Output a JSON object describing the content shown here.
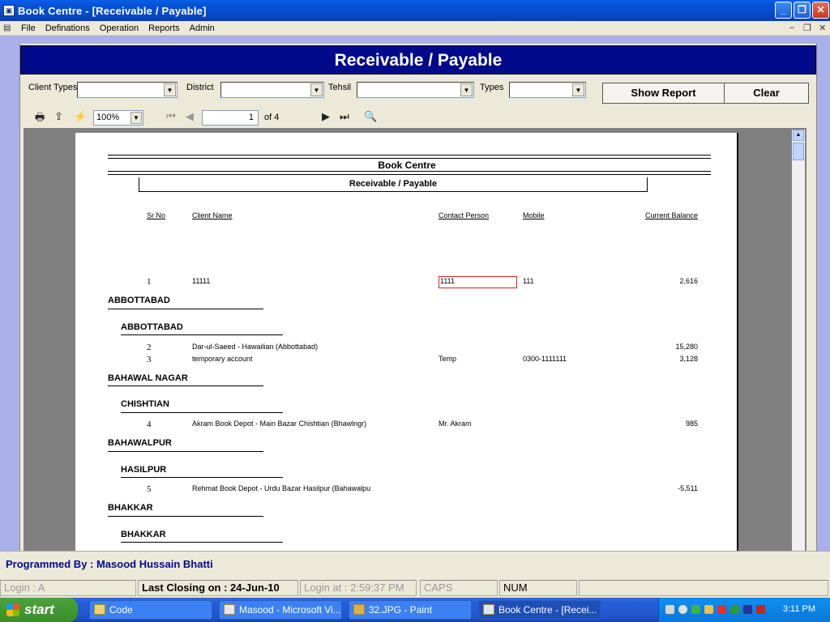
{
  "window": {
    "title": "Book Centre  - [Receivable / Payable]"
  },
  "menu": {
    "items": [
      "File",
      "Definations",
      "Operation",
      "Reports",
      "Admin"
    ]
  },
  "header": {
    "title": "Receivable / Payable"
  },
  "filters": {
    "client_types_label": "Client Types",
    "district_label": "District",
    "tehsil_label": "Tehsil",
    "types_label": "Types",
    "client_types_value": "",
    "district_value": "",
    "tehsil_value": "",
    "types_value": "",
    "show_report_label": "Show Report",
    "clear_label": "Clear"
  },
  "viewer": {
    "zoom": "100%",
    "page": "1",
    "of_pages": "of 4"
  },
  "report": {
    "company": "Book Centre",
    "subtitle": "Receivable / Payable",
    "columns": {
      "sr": "Sr No",
      "client": "Client Name",
      "contact": "Contact Person",
      "mobile": "Mobile",
      "balance": "Current Balance"
    },
    "rows": [
      {
        "sr": "1",
        "client": "11111",
        "contact": "1111",
        "mobile": "111",
        "balance": "2,616"
      },
      {
        "sr": "2",
        "client": "Dar-ul-Saeed - Hawailian (Abbottabad)",
        "contact": "",
        "mobile": "",
        "balance": "15,280"
      },
      {
        "sr": "3",
        "client": "temporary account",
        "contact": "Temp",
        "mobile": "0300-1111111",
        "balance": "3,128"
      },
      {
        "sr": "4",
        "client": "Akram Book Depot - Main Bazar Chishtian (Bhawlngr)",
        "contact": "Mr. Akram",
        "mobile": "",
        "balance": "985"
      },
      {
        "sr": "5",
        "client": "Rehmat Book Depot - Urdu Bazar Hasilpur (Bahawalpu",
        "contact": "",
        "mobile": "",
        "balance": "-5,511"
      }
    ],
    "groups": {
      "d1": "ABBOTTABAD",
      "t1": "ABBOTTABAD",
      "d2": "BAHAWAL NAGAR",
      "t2": "CHISHTIAN",
      "d3": "BAHAWALPUR",
      "t3": "HASILPUR",
      "d4": "BHAKKAR",
      "t4": "BHAKKAR"
    }
  },
  "status": {
    "programmed_by": "Programmed By : Masood Hussain Bhatti",
    "login": "Login :  A",
    "last_closing": "Last Closing on : 24-Jun-10",
    "login_at": "Login at : 2:59:37 PM",
    "caps": "CAPS",
    "num": "NUM"
  },
  "taskbar": {
    "start": "start",
    "tasks": [
      "Code",
      "Masood - Microsoft Vi...",
      "32.JPG - Paint",
      "Book Centre  - [Recei..."
    ],
    "clock": "3:11 PM"
  }
}
